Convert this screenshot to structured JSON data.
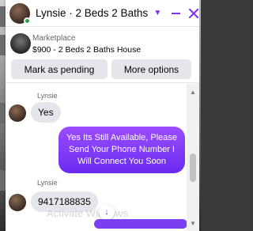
{
  "header": {
    "title": "Lynsie · 2 Beds 2 Baths Ho...",
    "status": "online"
  },
  "marketplace": {
    "label": "Marketplace",
    "listing": "$900 - 2 Beds 2 Baths House",
    "buttons": {
      "pending": "Mark as pending",
      "more": "More options"
    }
  },
  "messages": [
    {
      "sender": "Lynsie",
      "text": "Yes",
      "direction": "incoming"
    },
    {
      "sender": "",
      "text": "Yes Its Still Available, Please Send Your Phone Number I Will Connect You Soon",
      "direction": "outgoing"
    },
    {
      "sender": "Lynsie",
      "text": "9417188835",
      "direction": "incoming"
    }
  ],
  "watermark": "Activate Windows",
  "colors": {
    "accent": "#7b2ff7",
    "bubble_in": "#e4e6eb",
    "online": "#31a24c"
  },
  "icons": [
    "chevron-down-icon",
    "minimize-icon",
    "close-icon",
    "arrow-down-icon"
  ]
}
